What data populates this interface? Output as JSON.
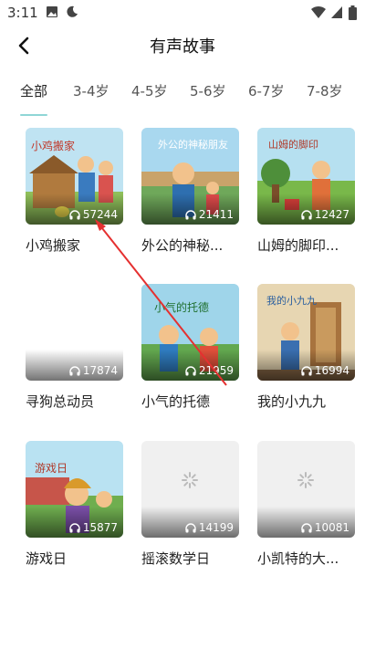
{
  "status": {
    "time": "3:11"
  },
  "header": {
    "title": "有声故事"
  },
  "tabs": [
    {
      "label": "全部",
      "active": true
    },
    {
      "label": "3-4岁"
    },
    {
      "label": "4-5岁"
    },
    {
      "label": "5-6岁"
    },
    {
      "label": "6-7岁"
    },
    {
      "label": "7-8岁"
    }
  ],
  "colors": {
    "tab_indicator": "#8fd6d6",
    "annotation_arrow": "#e53030"
  },
  "stories": [
    {
      "title": "小鸡搬家",
      "plays": "57244",
      "cover_text": "小鸡搬家",
      "loaded": true
    },
    {
      "title": "外公的神秘...",
      "plays": "21411",
      "cover_text": "外公的神秘朋友",
      "loaded": true
    },
    {
      "title": "山姆的脚印...",
      "plays": "12427",
      "cover_text": "山姆的脚印",
      "loaded": true
    },
    {
      "title": "寻狗总动员",
      "plays": "17874",
      "cover_text": "",
      "loaded": false
    },
    {
      "title": "小气的托德",
      "plays": "21959",
      "cover_text": "小气的托德",
      "loaded": true
    },
    {
      "title": "我的小九九",
      "plays": "16994",
      "cover_text": "我的小九九",
      "loaded": true
    },
    {
      "title": "游戏日",
      "plays": "15877",
      "cover_text": "游戏日",
      "loaded": true
    },
    {
      "title": "摇滚数学日",
      "plays": "14199",
      "cover_text": "",
      "loaded": false
    },
    {
      "title": "小凯特的大...",
      "plays": "10081",
      "cover_text": "",
      "loaded": false
    }
  ]
}
